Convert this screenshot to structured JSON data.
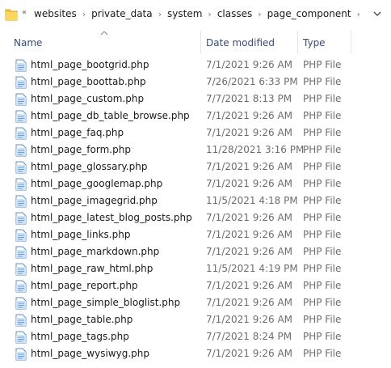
{
  "address": {
    "overflow_label": "«",
    "crumbs": [
      "websites",
      "private_data",
      "system",
      "classes",
      "page_component"
    ]
  },
  "columns": {
    "name": "Name",
    "date": "Date modified",
    "type": "Type"
  },
  "files": [
    {
      "name": "html_page_bootgrid.php",
      "date": "7/1/2021 9:26 AM",
      "type": "PHP File"
    },
    {
      "name": "html_page_boottab.php",
      "date": "7/26/2021 6:33 PM",
      "type": "PHP File"
    },
    {
      "name": "html_page_custom.php",
      "date": "7/7/2021 8:13 PM",
      "type": "PHP File"
    },
    {
      "name": "html_page_db_table_browse.php",
      "date": "7/1/2021 9:26 AM",
      "type": "PHP File"
    },
    {
      "name": "html_page_faq.php",
      "date": "7/1/2021 9:26 AM",
      "type": "PHP File"
    },
    {
      "name": "html_page_form.php",
      "date": "11/28/2021 3:16 PM",
      "type": "PHP File"
    },
    {
      "name": "html_page_glossary.php",
      "date": "7/1/2021 9:26 AM",
      "type": "PHP File"
    },
    {
      "name": "html_page_googlemap.php",
      "date": "7/1/2021 9:26 AM",
      "type": "PHP File"
    },
    {
      "name": "html_page_imagegrid.php",
      "date": "11/5/2021 4:18 PM",
      "type": "PHP File"
    },
    {
      "name": "html_page_latest_blog_posts.php",
      "date": "7/1/2021 9:26 AM",
      "type": "PHP File"
    },
    {
      "name": "html_page_links.php",
      "date": "7/1/2021 9:26 AM",
      "type": "PHP File"
    },
    {
      "name": "html_page_markdown.php",
      "date": "7/1/2021 9:26 AM",
      "type": "PHP File"
    },
    {
      "name": "html_page_raw_html.php",
      "date": "11/5/2021 4:19 PM",
      "type": "PHP File"
    },
    {
      "name": "html_page_report.php",
      "date": "7/1/2021 9:26 AM",
      "type": "PHP File"
    },
    {
      "name": "html_page_simple_bloglist.php",
      "date": "7/1/2021 9:26 AM",
      "type": "PHP File"
    },
    {
      "name": "html_page_table.php",
      "date": "7/1/2021 9:26 AM",
      "type": "PHP File"
    },
    {
      "name": "html_page_tags.php",
      "date": "7/7/2021 8:24 PM",
      "type": "PHP File"
    },
    {
      "name": "html_page_wysiwyg.php",
      "date": "7/1/2021 9:26 AM",
      "type": "PHP File"
    }
  ],
  "icons": {
    "folder": "folder-icon",
    "file": "php-file-icon",
    "dropdown": "chevron-down-icon",
    "sort": "sort-ascending-icon"
  },
  "colors": {
    "header_text": "#3a4c73",
    "secondary_text": "#6d6d6d"
  }
}
